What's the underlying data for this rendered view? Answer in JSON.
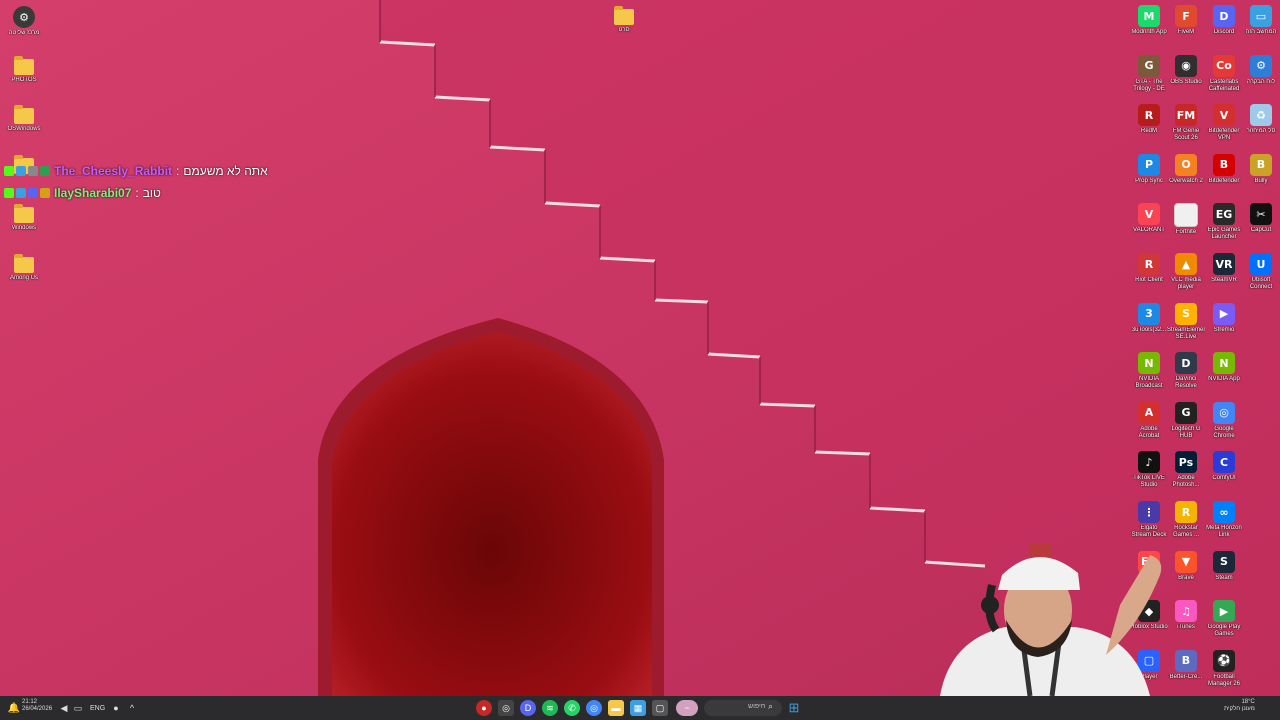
{
  "desktop_left": [
    {
      "id": "d1",
      "label": "מרכז שליטה",
      "icon": "control-panel-icon",
      "color": "#555555"
    },
    {
      "id": "d2",
      "label": "PHOTOS",
      "icon": "folder-icon",
      "color": "#f5c84a"
    },
    {
      "id": "d3",
      "label": "OSWindows",
      "icon": "folder-icon",
      "color": "#f5c84a"
    },
    {
      "id": "d4",
      "label": "",
      "icon": "folder-icon",
      "color": "#f5c84a"
    },
    {
      "id": "d5",
      "label": "Windows",
      "icon": "folder-icon",
      "color": "#f5c84a"
    },
    {
      "id": "d6",
      "label": "Among Us",
      "icon": "folder-icon",
      "color": "#f5c84a"
    }
  ],
  "desktop_top_folder": {
    "label": "סרט",
    "icon": "folder-icon"
  },
  "chat": [
    {
      "user": "The_Cheesly_Rabbit",
      "sep": ":",
      "message": "אתה לא משעמם",
      "user_color": "#c45cff"
    },
    {
      "user": "IlaySharabi07",
      "sep": ":",
      "message": "טוב",
      "user_color": "#7df07a"
    }
  ],
  "desktop_right": [
    {
      "label": "Modrinth App",
      "icon": "modrinth-icon",
      "color": "#1bd96a",
      "glyph": "M"
    },
    {
      "label": "FiveM",
      "icon": "fivem-icon",
      "color": "#e04a2f",
      "glyph": "F"
    },
    {
      "label": "Discord",
      "icon": "discord-icon",
      "color": "#5865f2",
      "glyph": "D"
    },
    {
      "label": "המחשב הזה",
      "icon": "this-pc-icon",
      "color": "#3aa0e0",
      "glyph": "▭"
    },
    {
      "label": "GTA - The Trilogy - DE",
      "icon": "gta-icon",
      "color": "#7a5a3a",
      "glyph": "G"
    },
    {
      "label": "OBS Studio",
      "icon": "obs-icon",
      "color": "#302e31",
      "glyph": "◉"
    },
    {
      "label": "Casterlabs Caffeinated",
      "icon": "casterlabs-icon",
      "color": "#e53935",
      "glyph": "Co"
    },
    {
      "label": "לוח הבקרה",
      "icon": "control-panel-icon",
      "color": "#2e7dd7",
      "glyph": "⚙"
    },
    {
      "label": "RedM",
      "icon": "redm-icon",
      "color": "#b71c1c",
      "glyph": "R"
    },
    {
      "label": "FM Genie Scout 26",
      "icon": "genie-scout-icon",
      "color": "#c62828",
      "glyph": "FM"
    },
    {
      "label": "Bitdefender VPN",
      "icon": "bitdefender-vpn-icon",
      "color": "#d32f2f",
      "glyph": "V"
    },
    {
      "label": "סל המיחזור",
      "icon": "recycle-bin-icon",
      "color": "#9ec9e8",
      "glyph": "♻"
    },
    {
      "label": "Prop Sync",
      "icon": "prop-sync-icon",
      "color": "#1e88e5",
      "glyph": "P"
    },
    {
      "label": "Overwatch 2",
      "icon": "overwatch-icon",
      "color": "#f58220",
      "glyph": "O"
    },
    {
      "label": "Bitdefender",
      "icon": "bitdefender-icon",
      "color": "#d50000",
      "glyph": "B"
    },
    {
      "label": "Bully",
      "icon": "bully-icon",
      "color": "#c9a227",
      "glyph": "B"
    },
    {
      "label": "VALORANT",
      "icon": "valorant-icon",
      "color": "#fa4454",
      "glyph": "V"
    },
    {
      "label": "Fortnite",
      "icon": "fortnite-icon",
      "color": "#f0f0f0",
      "glyph": ""
    },
    {
      "label": "Epic Games Launcher",
      "icon": "epic-games-icon",
      "color": "#2a2a2a",
      "glyph": "EG"
    },
    {
      "label": "CapCut",
      "icon": "capcut-icon",
      "color": "#111111",
      "glyph": "✂"
    },
    {
      "label": "Riot Client",
      "icon": "riot-client-icon",
      "color": "#d13639",
      "glyph": "R"
    },
    {
      "label": "VLC media player",
      "icon": "vlc-icon",
      "color": "#f08a00",
      "glyph": "▲"
    },
    {
      "label": "SteamVR",
      "icon": "steamvr-icon",
      "color": "#1b2838",
      "glyph": "VR"
    },
    {
      "label": "Ubisoft Connect",
      "icon": "ubisoft-icon",
      "color": "#0070ff",
      "glyph": "U"
    },
    {
      "label": "3uTools(32...",
      "icon": "3utools-icon",
      "color": "#1e88e5",
      "glyph": "3"
    },
    {
      "label": "StreamElements SE.Live",
      "icon": "streamelements-icon",
      "color": "#ffb300",
      "glyph": "S"
    },
    {
      "label": "Stremio",
      "icon": "stremio-icon",
      "color": "#7b5bf5",
      "glyph": "▶"
    },
    {
      "label": "",
      "icon": "blank-icon",
      "color": "",
      "glyph": ""
    },
    {
      "label": "NVIDIA Broadcast",
      "icon": "nvidia-broadcast-icon",
      "color": "#76b900",
      "glyph": "N"
    },
    {
      "label": "DaVinci Resolve",
      "icon": "davinci-icon",
      "color": "#2f3a4a",
      "glyph": "D"
    },
    {
      "label": "NVIDIA App",
      "icon": "nvidia-app-icon",
      "color": "#76b900",
      "glyph": "N"
    },
    {
      "label": "",
      "icon": "blank-icon",
      "color": "",
      "glyph": ""
    },
    {
      "label": "Adobe Acrobat",
      "icon": "acrobat-icon",
      "color": "#d32f2f",
      "glyph": "A"
    },
    {
      "label": "Logitech G HUB",
      "icon": "logitech-ghub-icon",
      "color": "#222222",
      "glyph": "G"
    },
    {
      "label": "Google Chrome",
      "icon": "chrome-icon",
      "color": "#4285f4",
      "glyph": "◎"
    },
    {
      "label": "",
      "icon": "blank-icon",
      "color": "",
      "glyph": ""
    },
    {
      "label": "TikTok LIVE Studio",
      "icon": "tiktok-icon",
      "color": "#111111",
      "glyph": "♪"
    },
    {
      "label": "Adobe Photosh...",
      "icon": "photoshop-icon",
      "color": "#001e36",
      "glyph": "Ps"
    },
    {
      "label": "ComfyUI",
      "icon": "comfyui-icon",
      "color": "#2a3bd6",
      "glyph": "C"
    },
    {
      "label": "",
      "icon": "blank-icon",
      "color": "",
      "glyph": ""
    },
    {
      "label": "Elgato Stream Deck",
      "icon": "elgato-icon",
      "color": "#4a3aa8",
      "glyph": "⋮"
    },
    {
      "label": "Rockstar Games ...",
      "icon": "rockstar-icon",
      "color": "#f4b400",
      "glyph": "R"
    },
    {
      "label": "Meta Horizon Link",
      "icon": "meta-icon",
      "color": "#0081fb",
      "glyph": "∞"
    },
    {
      "label": "",
      "icon": "blank-icon",
      "color": "",
      "glyph": ""
    },
    {
      "label": "EA",
      "icon": "ea-icon",
      "color": "#ff4747",
      "glyph": "EA"
    },
    {
      "label": "Brave",
      "icon": "brave-icon",
      "color": "#fb542b",
      "glyph": "▼"
    },
    {
      "label": "Steam",
      "icon": "steam-icon",
      "color": "#1b2838",
      "glyph": "S"
    },
    {
      "label": "",
      "icon": "blank-icon",
      "color": "",
      "glyph": ""
    },
    {
      "label": "Roblox Studio",
      "icon": "roblox-icon",
      "color": "#222222",
      "glyph": "◆"
    },
    {
      "label": "iTunes",
      "icon": "itunes-icon",
      "color": "#fa57c1",
      "glyph": "♫"
    },
    {
      "label": "Google Play Games",
      "icon": "google-play-games-icon",
      "color": "#34a853",
      "glyph": "▶"
    },
    {
      "label": "",
      "icon": "blank-icon",
      "color": "",
      "glyph": ""
    },
    {
      "label": "Player",
      "icon": "player-icon",
      "color": "#2962ff",
      "glyph": "▢"
    },
    {
      "label": "Better-Cre...",
      "icon": "bettercrew-icon",
      "color": "#5c6bc0",
      "glyph": "B"
    },
    {
      "label": "Football Manager 26",
      "icon": "football-manager-icon",
      "color": "#222222",
      "glyph": "⚽"
    }
  ],
  "taskbar": {
    "time": "21:12",
    "date": "26/04/2026",
    "language": "ENG",
    "search_placeholder": "חיפוש",
    "tray_right_label": "מעונן חלקית",
    "temperature": "18°C"
  }
}
